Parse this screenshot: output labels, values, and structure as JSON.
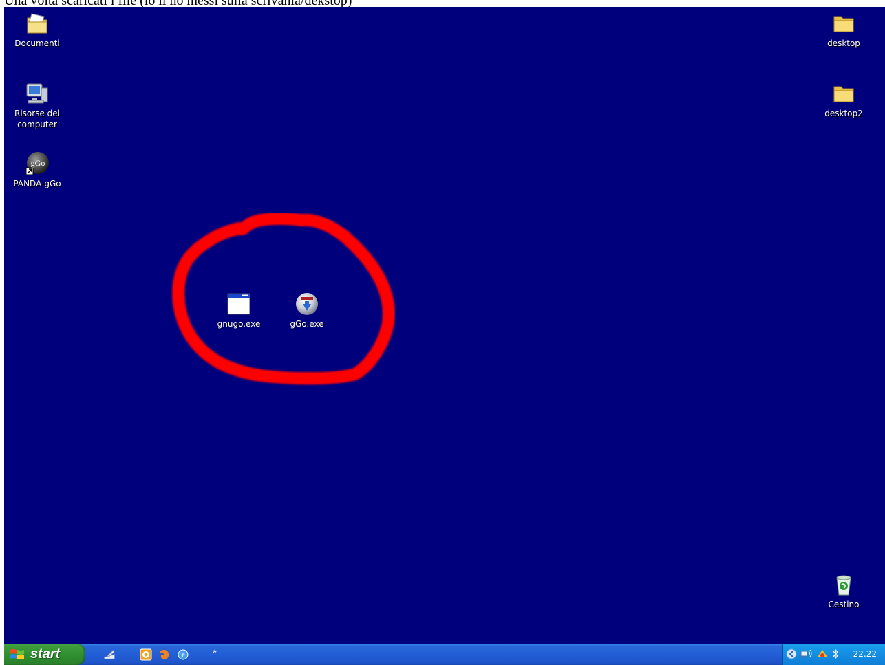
{
  "caption": "Una volta scaricati i file (io li ho messi sulla scrivania/dekstop)",
  "desktop": {
    "background_color": "#00007d",
    "icons_left": [
      {
        "label": "Documenti",
        "icon": "my-documents-icon"
      },
      {
        "label": "Risorse del computer",
        "icon": "my-computer-icon"
      },
      {
        "label": "PANDA-gGo",
        "icon": "ggo-shortcut-icon",
        "glyph": "gGo"
      }
    ],
    "icons_right": [
      {
        "label": "desktop",
        "icon": "folder-icon"
      },
      {
        "label": "desktop2",
        "icon": "folder-icon"
      },
      {
        "label": "Cestino",
        "icon": "recycle-bin-icon"
      }
    ],
    "icons_highlighted": [
      {
        "label": "gnugo.exe",
        "icon": "application-window-icon"
      },
      {
        "label": "gGo.exe",
        "icon": "ggo-installer-icon"
      }
    ],
    "highlight_color": "#ff0000"
  },
  "taskbar": {
    "start_label": "start",
    "quick_launch": [
      "show-desktop-icon",
      "media-player-icon",
      "firefox-icon",
      "internet-explorer-icon"
    ],
    "overflow": "»",
    "clock": "22.22",
    "tray_icons": [
      "tray-expand-icon",
      "network-icon",
      "security-icon",
      "bluetooth-icon"
    ]
  }
}
